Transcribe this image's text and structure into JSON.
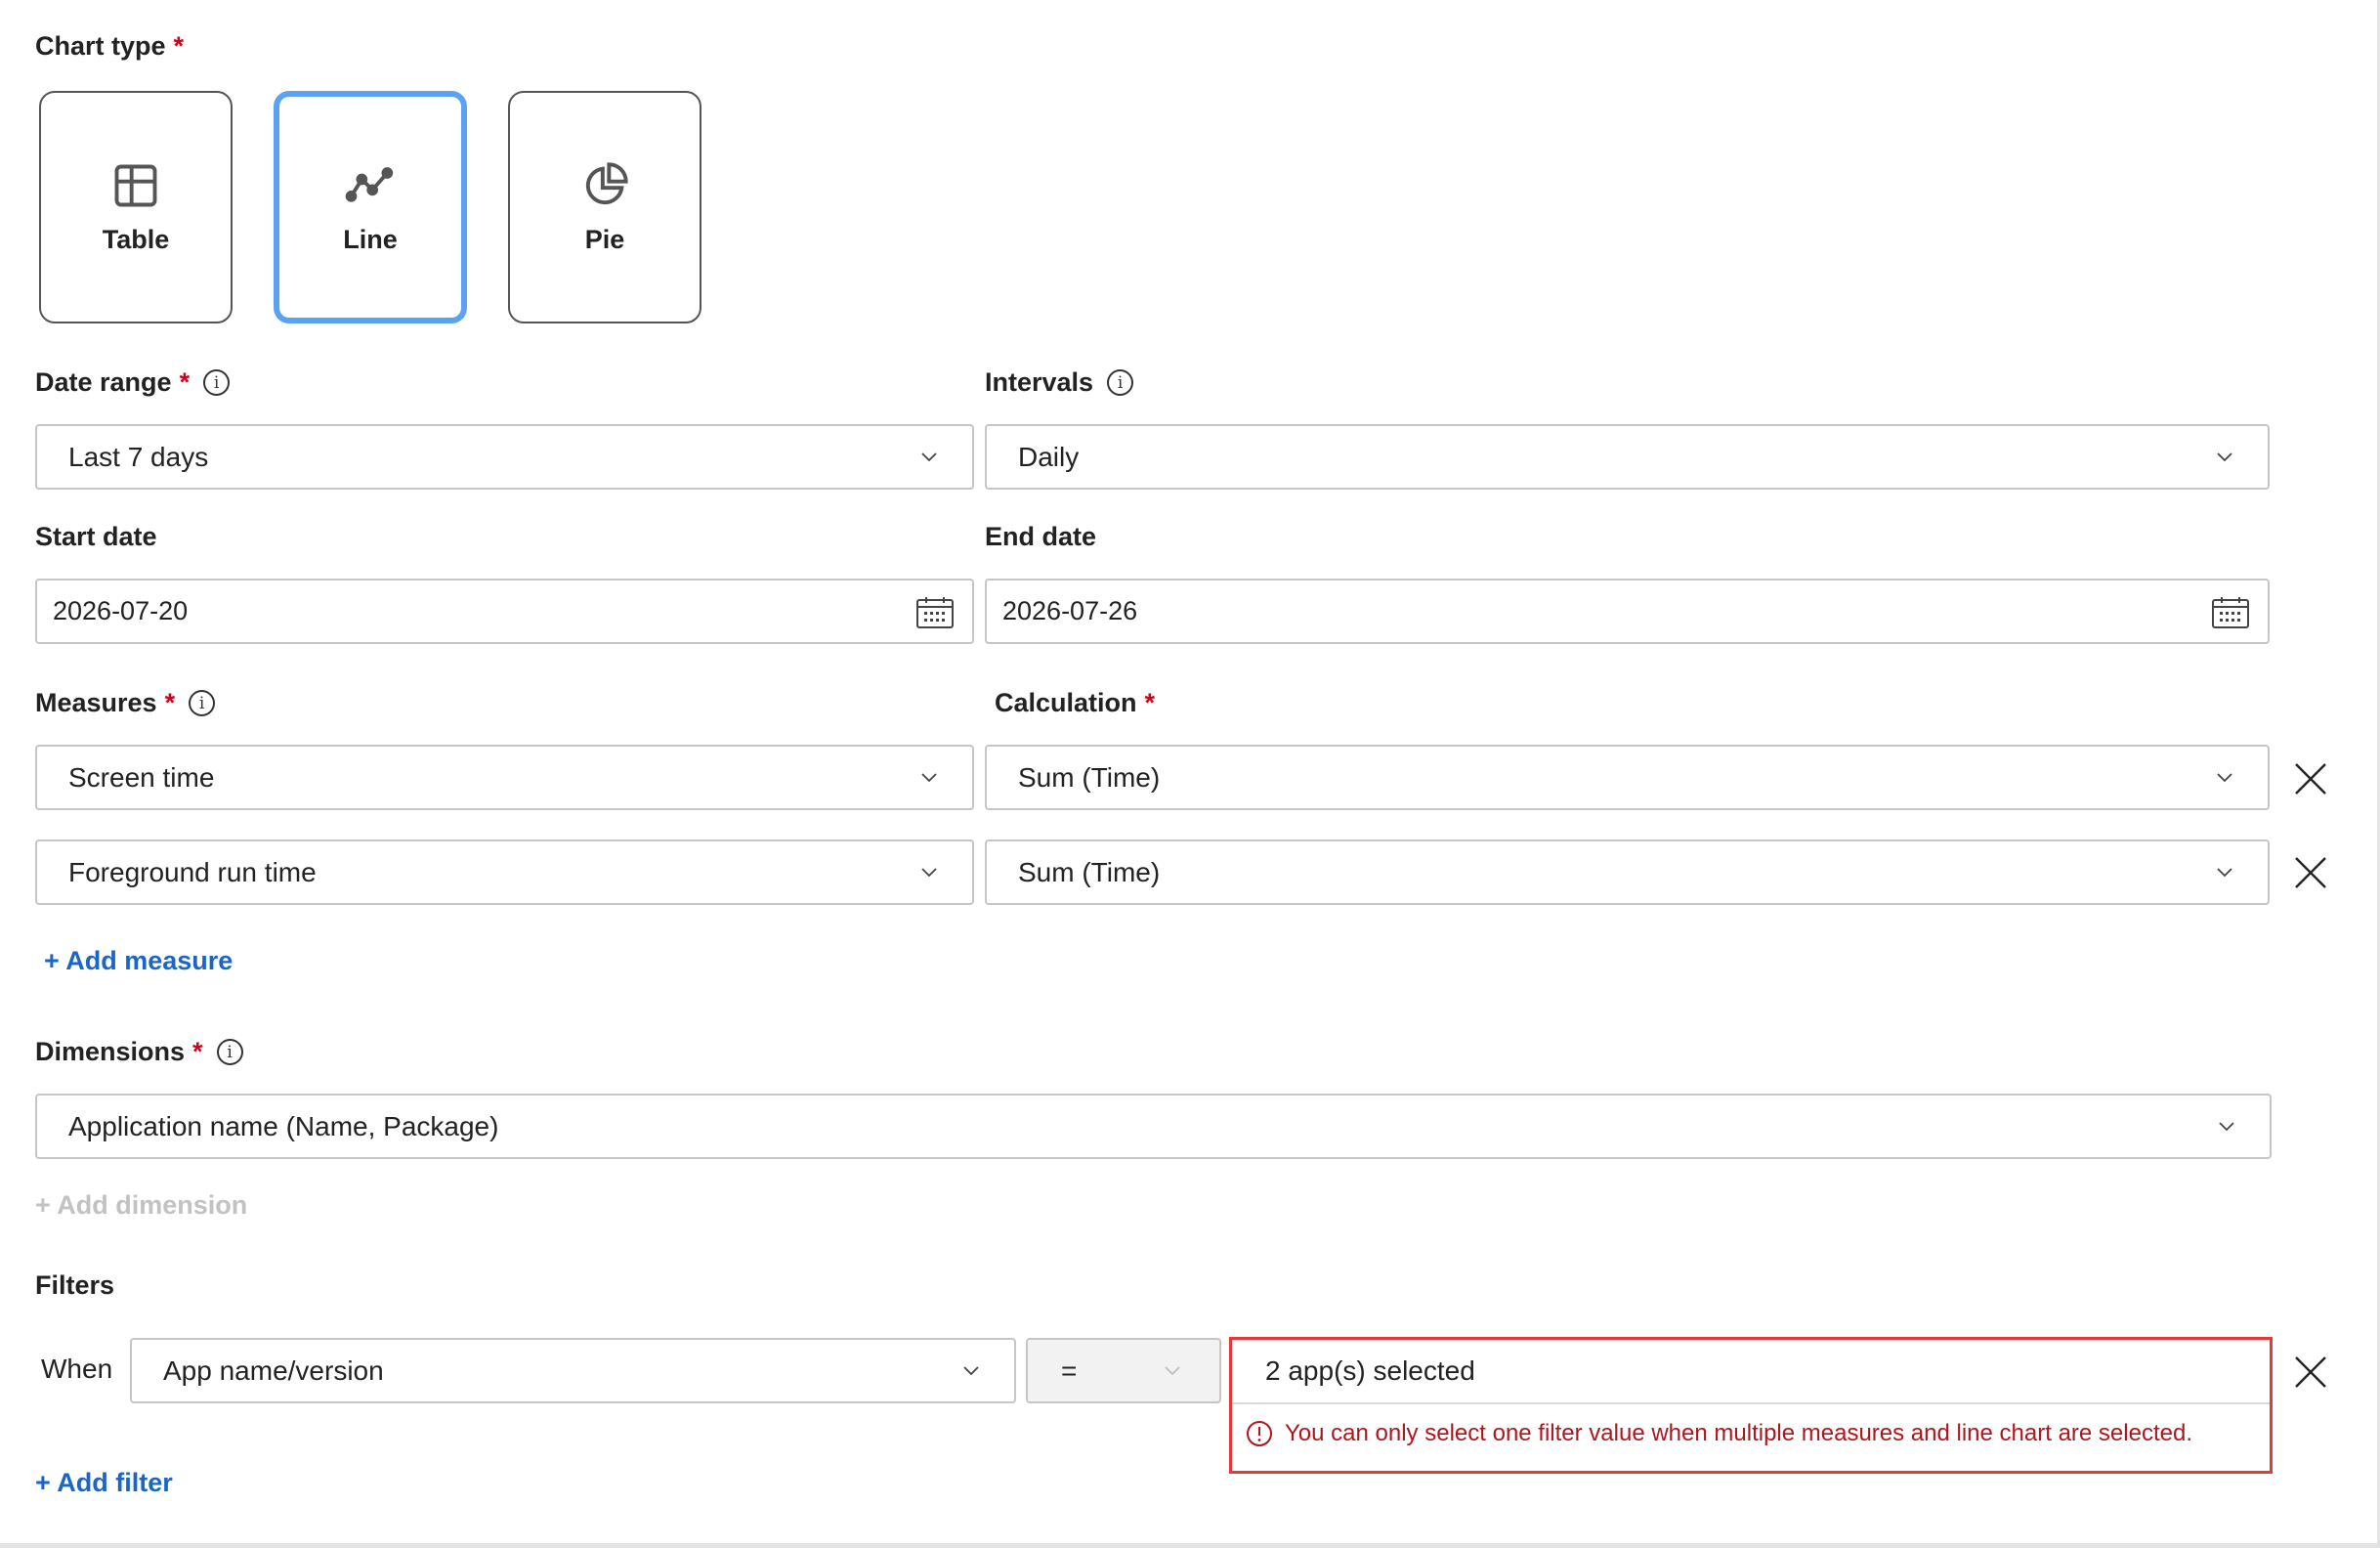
{
  "chart_type": {
    "label": "Chart type",
    "required_mark": "*",
    "options": [
      {
        "label": "Table",
        "icon": "table-icon"
      },
      {
        "label": "Line",
        "icon": "line-chart-icon",
        "selected": true
      },
      {
        "label": "Pie",
        "icon": "pie-chart-icon"
      }
    ]
  },
  "date_range": {
    "label": "Date range",
    "required_mark": "*",
    "info_glyph": "i",
    "value": "Last 7 days"
  },
  "intervals": {
    "label": "Intervals",
    "info_glyph": "i",
    "value": "Daily"
  },
  "start_date": {
    "label": "Start date",
    "value": "2026-07-20"
  },
  "end_date": {
    "label": "End date",
    "value": "2026-07-26"
  },
  "measures": {
    "label": "Measures",
    "required_mark": "*",
    "info_glyph": "i",
    "rows": [
      {
        "measure": "Screen time",
        "calculation": "Sum (Time)"
      },
      {
        "measure": "Foreground run time",
        "calculation": "Sum (Time)"
      }
    ],
    "add_label": "+ Add measure"
  },
  "calculation": {
    "label": "Calculation",
    "required_mark": "*"
  },
  "dimensions": {
    "label": "Dimensions",
    "required_mark": "*",
    "info_glyph": "i",
    "value": "Application name (Name, Package)",
    "add_label": "+ Add dimension"
  },
  "filters": {
    "label": "Filters",
    "when_label": "When",
    "field_value": "App name/version",
    "operator_value": "=",
    "selection_value": "2 app(s) selected",
    "error_message": "You can only select one filter value when multiple measures and line chart are selected.",
    "add_label": "+ Add filter"
  },
  "colors": {
    "accent": "#1a66c8",
    "selected_border": "#5ba2f4",
    "required": "#d0021b",
    "error": "#e03a3a"
  }
}
